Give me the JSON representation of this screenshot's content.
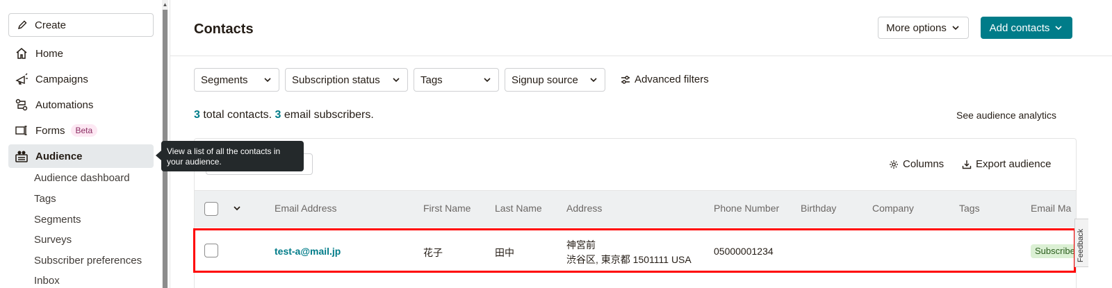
{
  "sidebar": {
    "create_label": "Create",
    "items": [
      {
        "label": "Home",
        "icon": "home-icon"
      },
      {
        "label": "Campaigns",
        "icon": "megaphone-icon"
      },
      {
        "label": "Automations",
        "icon": "automation-icon"
      },
      {
        "label": "Forms",
        "icon": "forms-icon",
        "badge": "Beta"
      },
      {
        "label": "Audience",
        "icon": "audience-icon",
        "active": true
      }
    ],
    "sub_items": [
      "Audience dashboard",
      "Tags",
      "Segments",
      "Surveys",
      "Subscriber preferences",
      "Inbox"
    ]
  },
  "tooltip": {
    "line1": "View a list of all the contacts in",
    "line2": "your audience."
  },
  "header": {
    "title": "Contacts",
    "more_options": "More options",
    "add_contacts": "Add contacts"
  },
  "filters": {
    "items": [
      "Segments",
      "Subscription status",
      "Tags",
      "Signup source"
    ],
    "advanced": "Advanced filters"
  },
  "summary": {
    "total_count": "3",
    "total_text": "total contacts.",
    "email_count": "3",
    "email_text": "email subscribers.",
    "analytics_link": "See audience analytics"
  },
  "toolbar": {
    "columns": "Columns",
    "export": "Export audience"
  },
  "table": {
    "headers": [
      "Email Address",
      "First Name",
      "Last Name",
      "Address",
      "Phone Number",
      "Birthday",
      "Company",
      "Tags",
      "Email Ma"
    ],
    "rows": [
      {
        "email": "test-a@mail.jp",
        "first_name": "花子",
        "last_name": "田中",
        "address_line1": "神宮前",
        "address_line2": "渋谷区, 東京都 1501111 USA",
        "phone": "05000001234",
        "birthday": "",
        "company": "",
        "tags": "",
        "status": "Subscribed"
      }
    ]
  },
  "feedback": "Feedback",
  "colors": {
    "accent": "#007c89",
    "highlight": "#ff0000",
    "badge_bg": "#dbf0d4"
  }
}
